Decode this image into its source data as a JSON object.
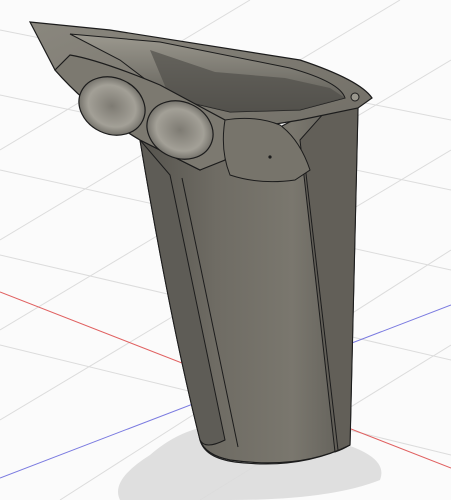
{
  "viewport": {
    "background": "#fbfbfb",
    "grid_color": "#dcdcdc",
    "axis_x_color": "#e06060",
    "axis_y_color": "#7a7ae0",
    "shadow_color": "#dcdcdc"
  },
  "model": {
    "body_color": "#6f6c64",
    "body_light_color": "#8c8980",
    "body_dark_color": "#4a4843",
    "edge_color": "#1c1c1c",
    "hole_count": 2
  }
}
